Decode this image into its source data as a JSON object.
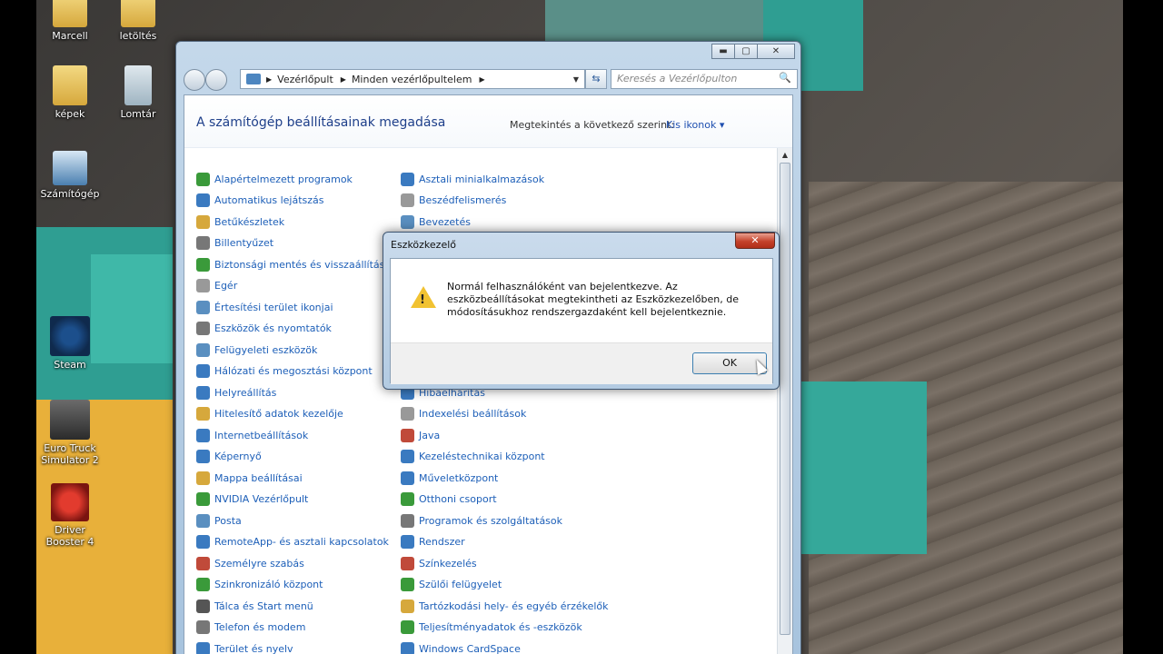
{
  "desktop": {
    "icons": [
      {
        "label": "Marcell",
        "icon": "folder-icon"
      },
      {
        "label": "letöltés",
        "icon": "folder-icon"
      },
      {
        "label": "képek",
        "icon": "folder-icon"
      },
      {
        "label": "Lomtár",
        "icon": "recycle-bin-icon"
      },
      {
        "label": "Számítógép",
        "icon": "computer-icon"
      },
      {
        "label": "Steam",
        "icon": "steam-icon"
      },
      {
        "label": "Euro Truck Simulator 2",
        "icon": "truck-icon"
      },
      {
        "label": "Driver Booster 4",
        "icon": "driver-booster-icon"
      }
    ]
  },
  "window": {
    "controls": {
      "minimize": "▬",
      "maximize": "▢",
      "close": "✕"
    },
    "address": {
      "segments": [
        "Vezérlőpult",
        "Minden vezérlőpultelem"
      ],
      "separator": "▶",
      "dropdown": "▼"
    },
    "search_placeholder": "Keresés a Vezérlőpulton",
    "search_icon": "🔍",
    "go_icon": "⇆",
    "title": "A számítógép beállításainak megadása",
    "view_label": "Megtekintés a következő szerint:",
    "view_value": "Kis ikonok ▾",
    "scroll_up": "▲"
  },
  "items_left": [
    {
      "label": "Alapértelmezett programok",
      "color": "#3a9a3a"
    },
    {
      "label": "Automatikus lejátszás",
      "color": "#3a7ac0"
    },
    {
      "label": "Betűkészletek",
      "color": "#d6a83c"
    },
    {
      "label": "Billentyűzet",
      "color": "#777777"
    },
    {
      "label": "Biztonsági mentés és visszaállítás",
      "color": "#3a9a3a"
    },
    {
      "label": "Egér",
      "color": "#999999"
    },
    {
      "label": "Értesítési terület ikonjai",
      "color": "#5a8fc0"
    },
    {
      "label": "Eszközök és nyomtatók",
      "color": "#777777"
    },
    {
      "label": "Felügyeleti eszközök",
      "color": "#5a8fc0"
    },
    {
      "label": "Hálózati és megosztási központ",
      "color": "#3a7ac0"
    },
    {
      "label": "Helyreállítás",
      "color": "#3a7ac0"
    },
    {
      "label": "Hitelesítő adatok kezelője",
      "color": "#d6a83c"
    },
    {
      "label": "Internetbeállítások",
      "color": "#3a7ac0"
    },
    {
      "label": "Képernyő",
      "color": "#3a7ac0"
    },
    {
      "label": "Mappa beállításai",
      "color": "#d6a83c"
    },
    {
      "label": "NVIDIA Vezérlőpult",
      "color": "#3a9a3a"
    },
    {
      "label": "Posta",
      "color": "#5a8fc0"
    },
    {
      "label": "RemoteApp- és asztali kapcsolatok",
      "color": "#3a7ac0"
    },
    {
      "label": "Személyre szabás",
      "color": "#c04a3a"
    },
    {
      "label": "Szinkronizáló központ",
      "color": "#3a9a3a"
    },
    {
      "label": "Tálca és Start menü",
      "color": "#555555"
    },
    {
      "label": "Telefon és modem",
      "color": "#777777"
    },
    {
      "label": "Terület és nyelv",
      "color": "#3a7ac0"
    }
  ],
  "items_right": [
    {
      "label": "Asztali minialkalmazások",
      "color": "#3a7ac0"
    },
    {
      "label": "Beszédfelismerés",
      "color": "#999999"
    },
    {
      "label": "Bevezetés",
      "color": "#5a8fc0"
    },
    {
      "label": "Hibaelhárítás",
      "color": "#3a7ac0"
    },
    {
      "label": "Indexelési beállítások",
      "color": "#999999"
    },
    {
      "label": "Java",
      "color": "#c04a3a"
    },
    {
      "label": "Kezeléstechnikai központ",
      "color": "#3a7ac0"
    },
    {
      "label": "Műveletközpont",
      "color": "#3a7ac0"
    },
    {
      "label": "Otthoni csoport",
      "color": "#3a9a3a"
    },
    {
      "label": "Programok és szolgáltatások",
      "color": "#777777"
    },
    {
      "label": "Rendszer",
      "color": "#3a7ac0"
    },
    {
      "label": "Színkezelés",
      "color": "#c04a3a"
    },
    {
      "label": "Szülői felügyelet",
      "color": "#3a9a3a"
    },
    {
      "label": "Tartózkodási hely- és egyéb érzékelők",
      "color": "#d6a83c"
    },
    {
      "label": "Teljesítményadatok és -eszközök",
      "color": "#3a9a3a"
    },
    {
      "label": "Windows CardSpace",
      "color": "#3a7ac0"
    }
  ],
  "dialog": {
    "title": "Eszközkezelő",
    "close": "✕",
    "warning_mark": "!",
    "message": "Normál felhasználóként van bejelentkezve. Az eszközbeállításokat megtekintheti az Eszközkezelőben, de módosításukhoz rendszergazdaként kell bejelentkeznie.",
    "ok_label": "OK"
  }
}
